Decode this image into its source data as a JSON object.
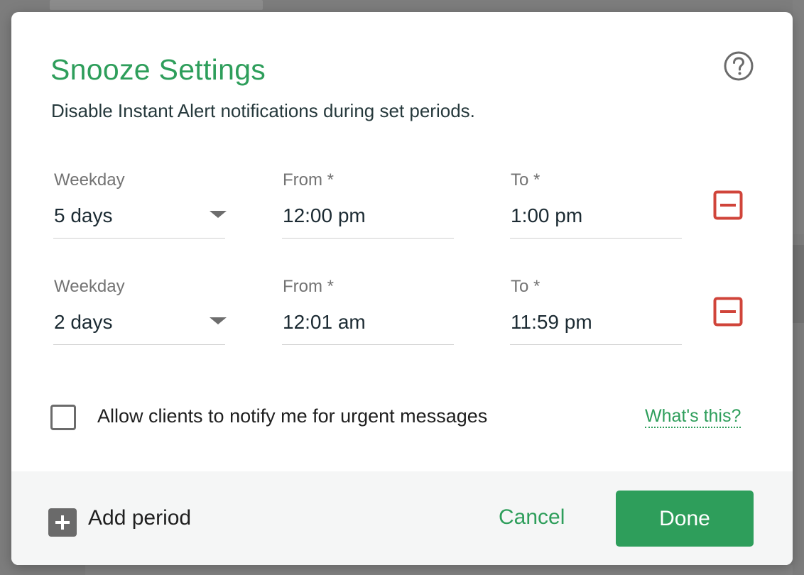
{
  "dialog": {
    "title": "Snooze Settings",
    "subtitle": "Disable Instant Alert notifications during set periods.",
    "help_icon": "question-circle-icon"
  },
  "periods": [
    {
      "weekday_label": "Weekday",
      "weekday_value": "5 days",
      "from_label": "From *",
      "from_value": "12:00 pm",
      "to_label": "To *",
      "to_value": "1:00 pm",
      "remove_icon": "minus-square-icon"
    },
    {
      "weekday_label": "Weekday",
      "weekday_value": "2 days",
      "from_label": "From *",
      "from_value": "12:01 am",
      "to_label": "To *",
      "to_value": "11:59 pm",
      "remove_icon": "minus-square-icon"
    }
  ],
  "urgent": {
    "label": "Allow clients to notify me for urgent messages",
    "checked": false,
    "whats_this": "What's this?"
  },
  "footer": {
    "add_period_label": "Add period",
    "add_icon": "plus-square-icon",
    "cancel_label": "Cancel",
    "done_label": "Done"
  },
  "colors": {
    "accent": "#2e9e5b",
    "danger": "#d0443a",
    "overlay": "#7d7d7d"
  }
}
